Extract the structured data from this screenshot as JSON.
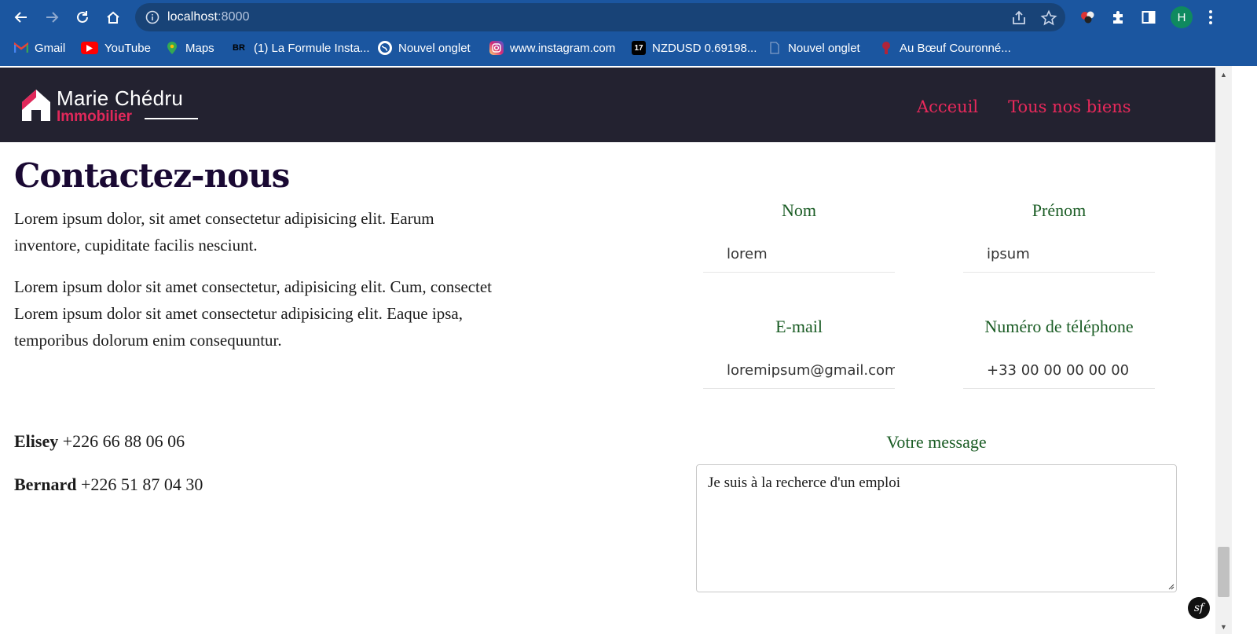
{
  "browser": {
    "url_host": "localhost",
    "url_port": ":8000",
    "avatar_initial": "H",
    "bookmarks": [
      {
        "label": "Gmail",
        "icon": "gmail-icon",
        "color": "#ea4335"
      },
      {
        "label": "YouTube",
        "icon": "youtube-icon",
        "color": "#ff0000"
      },
      {
        "label": "Maps",
        "icon": "maps-icon",
        "color": "#34a853"
      },
      {
        "label": "(1) La Formule Insta...",
        "icon": "br-icon",
        "color": "#000000"
      },
      {
        "label": "Nouvel onglet",
        "icon": "globe-icon",
        "color": "#ffffff"
      },
      {
        "label": "www.instagram.com",
        "icon": "instagram-icon",
        "color": "#d6249f"
      },
      {
        "label": "NZDUSD 0.69198...",
        "icon": "tradingview-icon",
        "color": "#000000"
      },
      {
        "label": "Nouvel onglet",
        "icon": "blank-page-icon",
        "color": "#3b6fb0"
      },
      {
        "label": "Au Bœuf Couronné...",
        "icon": "restaurant-icon",
        "color": "#b0243a"
      }
    ]
  },
  "site": {
    "logo_name": "Marie Chédru",
    "logo_sub": "Immobilier",
    "nav": [
      "Acceuil",
      "Tous nos biens"
    ],
    "accent": "#e8295b"
  },
  "page": {
    "heading": "Contactez-nous",
    "paragraph1": "Lorem ipsum dolor, sit amet consectetur adipisicing elit. Earum inventore, cupiditate facilis nesciunt.",
    "paragraph2": "Lorem ipsum dolor sit amet consectetur, adipisicing elit. Cum, consectet Lorem ipsum dolor sit amet consectetur adipisicing elit. Eaque ipsa, temporibus dolorum enim consequuntur.",
    "contacts": [
      {
        "name": "Elisey",
        "phone": "+226 66 88 06 06"
      },
      {
        "name": "Bernard",
        "phone": "+226 51 87 04 30"
      }
    ]
  },
  "form": {
    "nom_label": "Nom",
    "nom_value": "lorem",
    "prenom_label": "Prénom",
    "prenom_value": "ipsum",
    "email_label": "E-mail",
    "email_value": "loremipsum@gmail.com",
    "phone_label": "Numéro de téléphone",
    "phone_value": "+33 00 00 00 00 00",
    "message_label": "Votre message",
    "message_value": "Je suis à la recherce d'un emploi"
  }
}
